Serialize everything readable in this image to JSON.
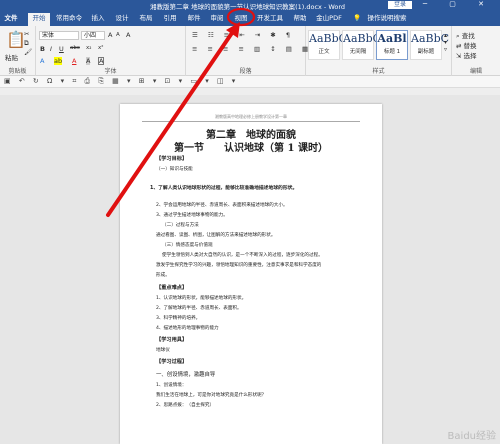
{
  "window": {
    "title": "湘教版第二章 地球的面貌第一节认识地球知识教案(1).docx - Word",
    "login": "登录",
    "controls": "▭ ─ ▢ ✕"
  },
  "tabs": [
    {
      "label": "文件"
    },
    {
      "label": "开始"
    },
    {
      "label": "常用命令"
    },
    {
      "label": "插入"
    },
    {
      "label": "设计"
    },
    {
      "label": "布局"
    },
    {
      "label": "引用"
    },
    {
      "label": "邮件"
    },
    {
      "label": "审阅"
    },
    {
      "label": "视图"
    },
    {
      "label": "开发工具"
    },
    {
      "label": "帮助"
    },
    {
      "label": "金山PDF"
    },
    {
      "label": "操作说明搜索"
    }
  ],
  "ribbon": {
    "clipboard": {
      "paste": "粘贴",
      "label": "剪贴板"
    },
    "font": {
      "name": "宋体",
      "size": "小四",
      "label": "字体",
      "size_up": "A",
      "size_down": "A",
      "clear": "A",
      "bold": "B",
      "italic": "I",
      "underline": "U",
      "strike": "abc",
      "sub": "x₂",
      "sup": "x²",
      "effects": "A",
      "highlight": "ab",
      "color": "A",
      "shade": "A",
      "border": "A"
    },
    "paragraph": {
      "label": "段落"
    },
    "styles": {
      "label": "样式",
      "items": [
        {
          "preview": "AaBbC",
          "name": "正文"
        },
        {
          "preview": "AaBbC",
          "name": "无间隔"
        },
        {
          "preview": "AaBl",
          "name": "标题 1"
        },
        {
          "preview": "AaBbC",
          "name": "副标题"
        }
      ]
    },
    "editing": {
      "label": "编辑",
      "find": "查找",
      "replace": "替换",
      "select": "选择"
    }
  },
  "qat": "▣ ↶ ↻ Ω ▾ ⌗ ⎙ ⎘ ▦ ▾ ⊞ ▾ ⊡ ▾ ▭ ▾ ◫ ▾",
  "page": {
    "header": "湘教版高中地理必修上册教学设计第一章",
    "chapter": "第二章　地球的面貌",
    "section": "第一节　　认识地球（第 1 课时）",
    "lines": [
      "【学习目标】",
      "（一）知识与技能",
      "1、了解人类认识地球形状的过程，能够比较准确地描述地球的形状。",
      "2、学会运用地球的半径、赤道周长、表面积来描述地球的大小。",
      "3、通过学生描述地球事物的能力。",
      "（二）过程与方法",
      "通过看图、读图、析图，让图解的方法来描述地球的形状。",
      "（三）情感态度与价值观",
      "使学生领悟到人类对大自然的认识，是一个不断深入的过程，逐步深化的过程。",
      "激发学生探究性学习的兴趣，领悟地理知识的重要性，注意实事求是和科学态度的",
      "形成。",
      "【重点难点】",
      "1、认识地球的形状，能够描述地球的形状。",
      "2、了解地球的半径、赤道周长、表面积。",
      "3、科学精神的培养。",
      "4、描述地形的地理事物的能力",
      "【学习用具】",
      "地球仪",
      "【学习过程】",
      "一、创设情境，激趣自导",
      "1、创设情境：",
      "我们生活在地球上，可是你对地球究竟是什么形状呢？",
      "2、思路点拨：　（自主探究）"
    ]
  },
  "watermark": "Baidu经验"
}
